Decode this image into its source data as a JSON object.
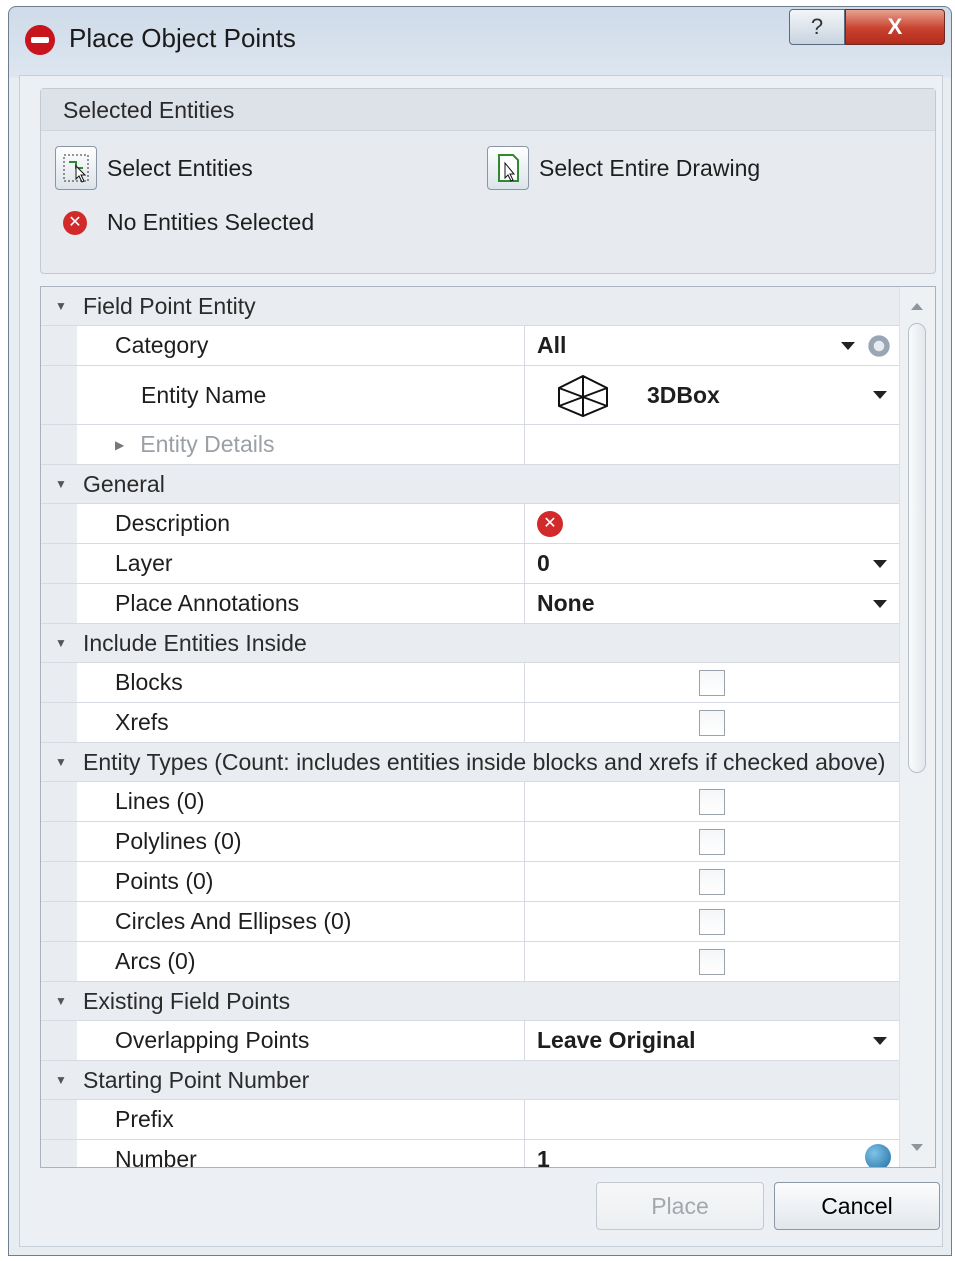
{
  "window": {
    "title": "Place Object Points",
    "help_label": "?",
    "close_label": "X"
  },
  "selected_entities": {
    "header": "Selected Entities",
    "select_entities_label": "Select Entities",
    "select_entire_drawing_label": "Select Entire Drawing",
    "status": "No Entities Selected"
  },
  "grid": {
    "field_point_entity": {
      "header": "Field Point Entity",
      "category_label": "Category",
      "category_value": "All",
      "entity_name_label": "Entity Name",
      "entity_name_value": "3DBox",
      "entity_details_label": "Entity Details"
    },
    "general": {
      "header": "General",
      "description_label": "Description",
      "layer_label": "Layer",
      "layer_value": "0",
      "place_annotations_label": "Place Annotations",
      "place_annotations_value": "None"
    },
    "include_inside": {
      "header": "Include Entities Inside",
      "blocks_label": "Blocks",
      "blocks_checked": false,
      "xrefs_label": "Xrefs",
      "xrefs_checked": false
    },
    "entity_types": {
      "header": "Entity Types (Count: includes entities inside blocks and xrefs if checked above)",
      "items": [
        {
          "label": "Lines  (0)",
          "checked": false
        },
        {
          "label": "Polylines  (0)",
          "checked": false
        },
        {
          "label": "Points  (0)",
          "checked": false
        },
        {
          "label": "Circles And Ellipses  (0)",
          "checked": false
        },
        {
          "label": "Arcs  (0)",
          "checked": false
        }
      ]
    },
    "existing_field_points": {
      "header": "Existing Field Points",
      "overlapping_label": "Overlapping Points",
      "overlapping_value": "Leave Original"
    },
    "starting_point_number": {
      "header": "Starting Point Number",
      "prefix_label": "Prefix",
      "prefix_value": "",
      "number_label": "Number",
      "number_value": "1"
    }
  },
  "buttons": {
    "place": "Place",
    "cancel": "Cancel"
  },
  "colors": {
    "error_red": "#d22a2a",
    "app_icon_red": "#c8141c"
  }
}
